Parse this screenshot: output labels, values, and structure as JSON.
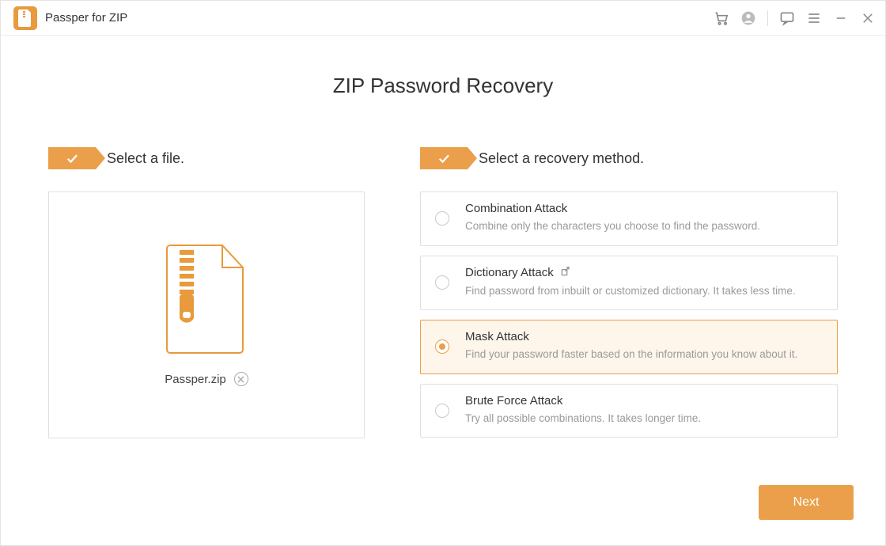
{
  "app": {
    "title": "Passper for ZIP"
  },
  "page": {
    "title": "ZIP Password Recovery"
  },
  "steps": {
    "select_file": "Select a file.",
    "select_method": "Select a recovery method."
  },
  "file": {
    "name": "Passper.zip"
  },
  "methods": [
    {
      "id": "combination",
      "title": "Combination Attack",
      "desc": "Combine only the characters you choose to find the password.",
      "selected": false,
      "ext_icon": false
    },
    {
      "id": "dictionary",
      "title": "Dictionary Attack",
      "desc": "Find password from inbuilt or customized dictionary. It takes less time.",
      "selected": false,
      "ext_icon": true
    },
    {
      "id": "mask",
      "title": "Mask Attack",
      "desc": "Find your password faster based on the information you know about it.",
      "selected": true,
      "ext_icon": false
    },
    {
      "id": "brute",
      "title": "Brute Force Attack",
      "desc": "Try all possible combinations. It takes longer time.",
      "selected": false,
      "ext_icon": false
    }
  ],
  "buttons": {
    "next": "Next"
  }
}
